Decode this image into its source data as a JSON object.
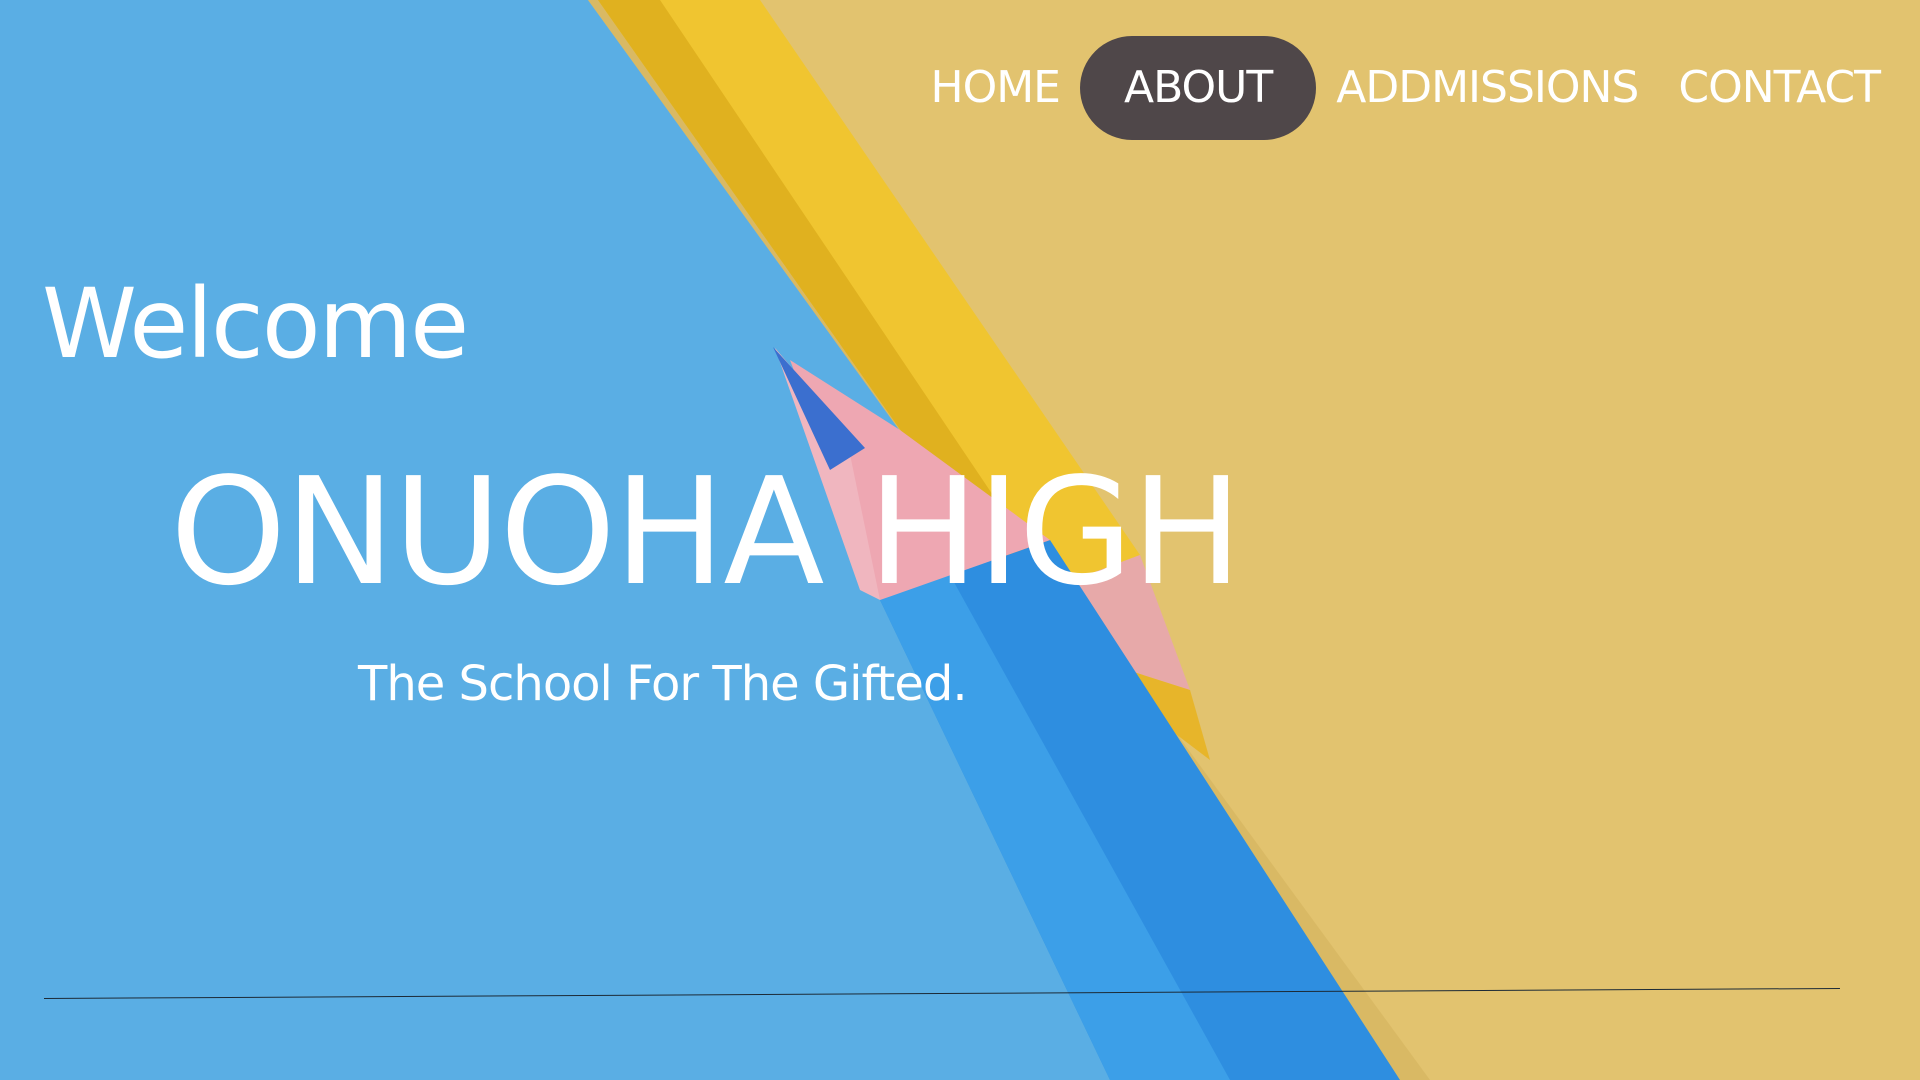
{
  "nav": {
    "items": [
      {
        "label": "HOME",
        "active": false
      },
      {
        "label": "ABOUT",
        "active": true
      },
      {
        "label": "ADDMISSIONS",
        "active": false
      },
      {
        "label": "CONTACT",
        "active": false
      }
    ]
  },
  "hero": {
    "welcome": "Welcome",
    "title": "ONUOHA HIGH",
    "tagline": "The School For The Gifted."
  },
  "colors": {
    "blue_background": "#5aaee4",
    "yellow_background": "#e3c26f",
    "active_nav_pill": "#4f4749",
    "text": "#ffffff"
  }
}
